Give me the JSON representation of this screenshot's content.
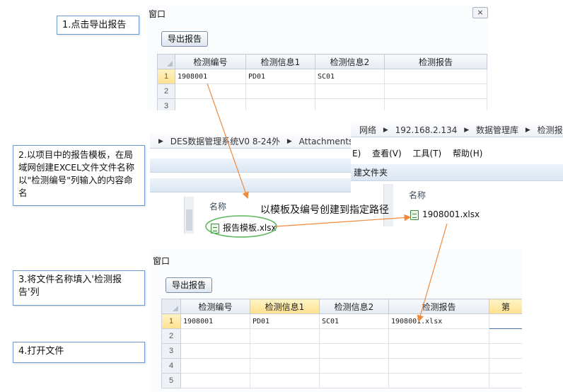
{
  "steps": [
    "1.点击导出报告",
    "2.以项目中的报告模板，在局域网创建EXCEL文件文件名称以\"检测编号\"列输入的内容命名",
    "3.将文件名称填入'检测报告'列",
    "4.打开文件"
  ],
  "window_top": {
    "title": "窗口",
    "close_label": "⨯",
    "export_button": "导出报告",
    "columns": [
      "检测编号",
      "检测信息1",
      "检测信息2",
      "检测报告"
    ],
    "rows": [
      {
        "n": "1",
        "cells": [
          "1908001",
          "PD01",
          "SC01",
          ""
        ]
      },
      {
        "n": "2",
        "cells": [
          "",
          "",
          "",
          ""
        ]
      },
      {
        "n": "3",
        "cells": [
          "",
          "",
          "",
          ""
        ]
      }
    ]
  },
  "explorer_left": {
    "breadcrumb": [
      "DES数据管理系统V0 8-24外",
      "Attachments"
    ],
    "column_name": "名称",
    "file": "报告模板.xlsx"
  },
  "explorer_right": {
    "breadcrumb": [
      "网络",
      "192.168.2.134",
      "数据管理库",
      "检测报告"
    ],
    "menu": [
      "E)",
      "查看(V)",
      "工具(T)",
      "帮助(H)"
    ],
    "toolbar_text": "建文件夹",
    "column_name": "名称",
    "file": "1908001.xlsx"
  },
  "annotation": "以模板及编号创建到指定路径",
  "window_bottom": {
    "title": "窗口",
    "export_button": "导出报告",
    "columns": [
      "检测编号",
      "检测信息1",
      "检测信息2",
      "检测报告",
      "第"
    ],
    "rows": [
      {
        "n": "1",
        "cells": [
          "1908001",
          "PD01",
          "SC01",
          "1908001.xlsx",
          ""
        ]
      },
      {
        "n": "2",
        "cells": [
          "",
          "",
          "",
          "",
          ""
        ]
      },
      {
        "n": "3",
        "cells": [
          "",
          "",
          "",
          "",
          ""
        ]
      },
      {
        "n": "4",
        "cells": [
          "",
          "",
          "",
          "",
          ""
        ]
      },
      {
        "n": "5",
        "cells": [
          "",
          "",
          "",
          "",
          ""
        ]
      }
    ]
  },
  "colors": {
    "arrow": "#f08a3c",
    "ellipse": "#5cb85c",
    "step_border": "#6f9ad0",
    "header_highlight": "#fde08d"
  }
}
